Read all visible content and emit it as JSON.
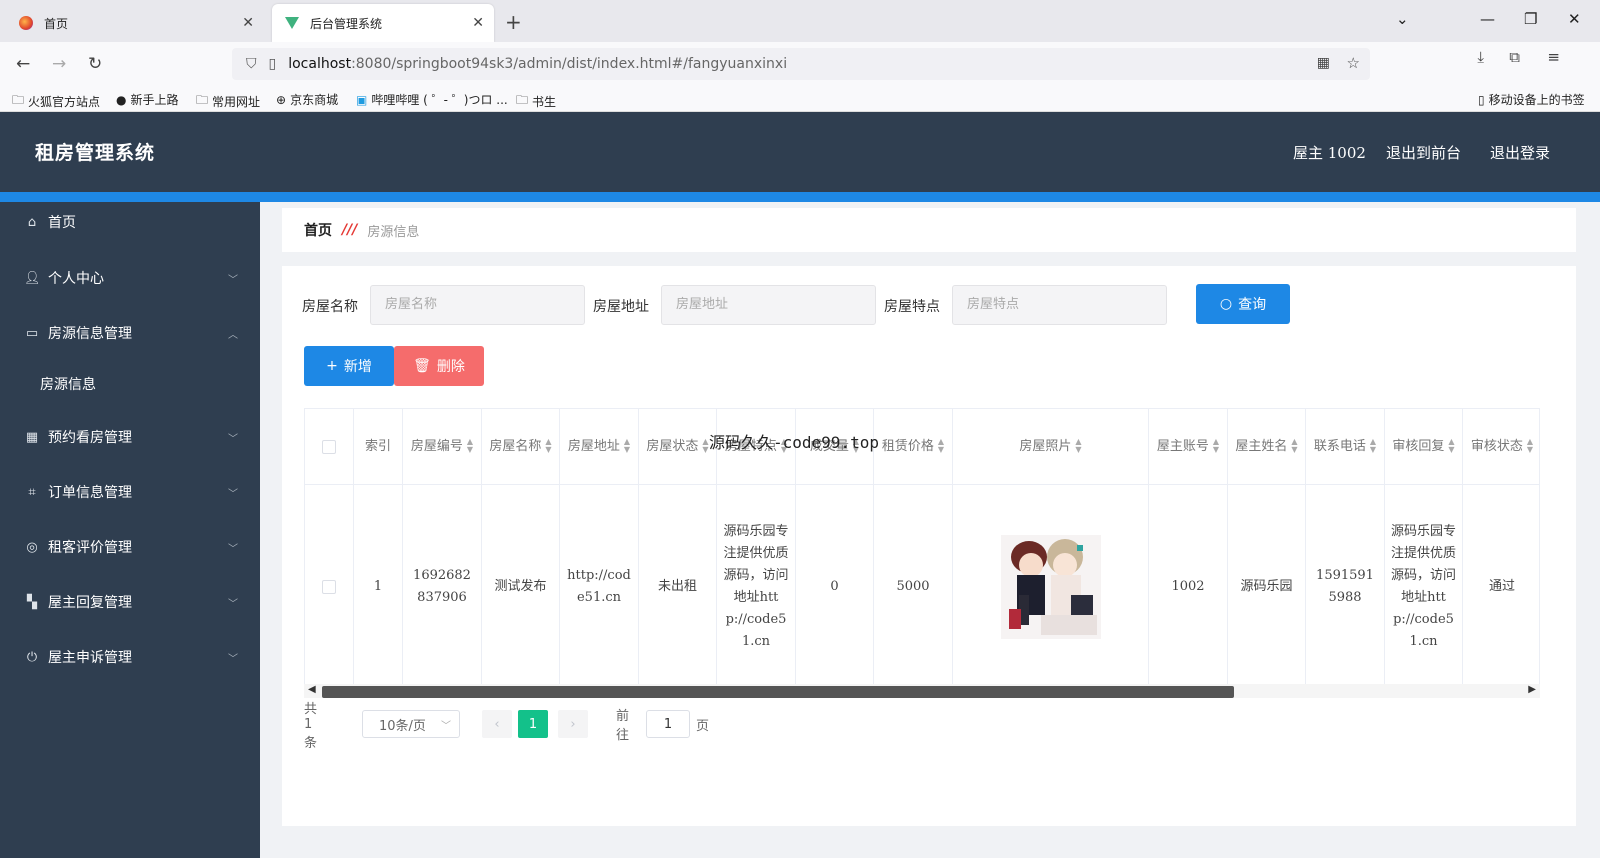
{
  "browser": {
    "tabs": [
      {
        "title": "首页",
        "active": false
      },
      {
        "title": "后台管理系统",
        "active": true
      }
    ],
    "url_host": "localhost",
    "url_rest": ":8080/springboot94sk3/admin/dist/index.html#/fangyuanxinxi",
    "bookmarks": [
      "火狐官方站点",
      "新手上路",
      "常用网址",
      "京东商城",
      "哔哩哔哩 ( ゜- ゜)つロ ...",
      "书生"
    ],
    "mobile_bookmarks": "移动设备上的书签"
  },
  "header": {
    "title": "租房管理系统",
    "user": "屋主 1002",
    "to_front": "退出到前台",
    "logout": "退出登录"
  },
  "sidebar": {
    "items": [
      {
        "label": "首页",
        "icon": "home-icon",
        "has_children": false
      },
      {
        "label": "个人中心",
        "icon": "user-icon",
        "has_children": true
      },
      {
        "label": "房源信息管理",
        "icon": "monitor-icon",
        "has_children": true,
        "expanded": true
      },
      {
        "label": "预约看房管理",
        "icon": "grid-icon",
        "has_children": true
      },
      {
        "label": "订单信息管理",
        "icon": "crop-icon",
        "has_children": true
      },
      {
        "label": "租客评价管理",
        "icon": "globe-icon",
        "has_children": true
      },
      {
        "label": "屋主回复管理",
        "icon": "apps-icon",
        "has_children": true
      },
      {
        "label": "屋主申诉管理",
        "icon": "power-icon",
        "has_children": true
      }
    ],
    "submenu": "房源信息"
  },
  "breadcrumb": {
    "home": "首页",
    "current": "房源信息"
  },
  "search": {
    "fields": [
      {
        "label": "房屋名称",
        "placeholder": "房屋名称"
      },
      {
        "label": "房屋地址",
        "placeholder": "房屋地址"
      },
      {
        "label": "房屋特点",
        "placeholder": "房屋特点"
      }
    ],
    "query_label": "查询"
  },
  "actions": {
    "add_label": "新增",
    "delete_label": "删除"
  },
  "table": {
    "columns": [
      {
        "label": "索引",
        "sortable": false
      },
      {
        "label": "房屋编号",
        "sortable": true
      },
      {
        "label": "房屋名称",
        "sortable": true
      },
      {
        "label": "房屋地址",
        "sortable": true
      },
      {
        "label": "房屋状态",
        "sortable": true
      },
      {
        "label": "房屋特点",
        "sortable": true
      },
      {
        "label": "成交量",
        "sortable": true
      },
      {
        "label": "租赁价格",
        "sortable": true
      },
      {
        "label": "房屋照片",
        "sortable": true
      },
      {
        "label": "屋主账号",
        "sortable": true
      },
      {
        "label": "屋主姓名",
        "sortable": true
      },
      {
        "label": "联系电话",
        "sortable": true
      },
      {
        "label": "审核回复",
        "sortable": true
      },
      {
        "label": "审核状态",
        "sortable": true
      }
    ],
    "rows": [
      {
        "index": "1",
        "house_no": "1692682837906",
        "house_name": "测试发布",
        "address": "http://code51.cn",
        "status": "未出租",
        "features": "源码乐园专注提供优质源码，访问地址http://code51.cn",
        "deals": "0",
        "price": "5000",
        "owner_account": "1002",
        "owner_name": "源码乐园",
        "phone": "15915915988",
        "review_reply": "源码乐园专注提供优质源码，访问地址http://code51.cn",
        "review_status": "通过"
      }
    ]
  },
  "pagination": {
    "total": "共 1 条",
    "page_size": "10条/页",
    "current_page": "1",
    "goto_prefix": "前往",
    "goto_value": "1",
    "goto_suffix": "页"
  },
  "overlay_text": "源码久久-code99.top",
  "colors": {
    "header_bg": "#2f3e50",
    "accent_blue": "#1e88e5",
    "danger": "#f56c6c",
    "page_active": "#13c18a"
  }
}
